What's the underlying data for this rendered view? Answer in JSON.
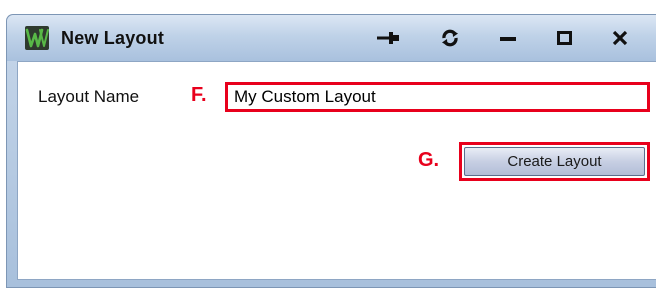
{
  "window": {
    "title": "New Layout",
    "controls": [
      {
        "name": "pin-icon"
      },
      {
        "name": "refresh-icon"
      },
      {
        "name": "minimize-icon"
      },
      {
        "name": "maximize-icon"
      },
      {
        "name": "close-icon"
      }
    ]
  },
  "form": {
    "layout_name_label": "Layout Name",
    "layout_name_value": "My Custom Layout",
    "create_button_label": "Create Layout"
  },
  "annotations": {
    "f_label": "F.",
    "g_label": "G."
  },
  "colors": {
    "annotation_red": "#e8001c",
    "titlebar_blue": "#bfd2e8",
    "app_icon_green": "#58b947"
  }
}
